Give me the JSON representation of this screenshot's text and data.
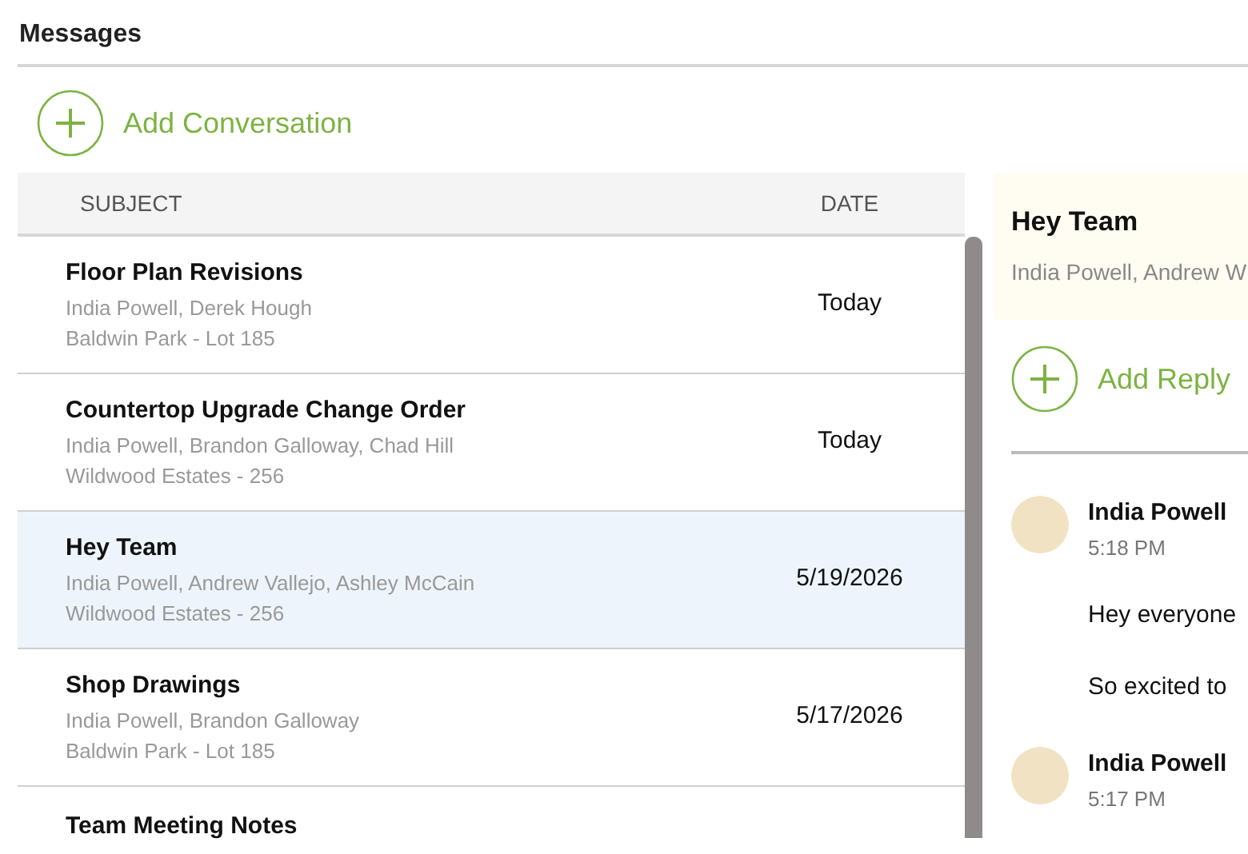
{
  "header": {
    "title": "Messages"
  },
  "add_conversation": {
    "label": "Add Conversation"
  },
  "table": {
    "columns": [
      "SUBJECT",
      "DATE"
    ],
    "rows": [
      {
        "subject": "Floor Plan Revisions",
        "participants": "India Powell, Derek Hough",
        "project": "Baldwin Park - Lot 185",
        "date": "Today",
        "selected": false
      },
      {
        "subject": "Countertop Upgrade Change Order",
        "participants": "India Powell, Brandon Galloway, Chad Hill",
        "project": "Wildwood Estates - 256",
        "date": "Today",
        "selected": false
      },
      {
        "subject": "Hey Team",
        "participants": "India Powell, Andrew Vallejo, Ashley McCain",
        "project": "Wildwood Estates - 256",
        "date": "5/19/2026",
        "selected": true
      },
      {
        "subject": "Shop Drawings",
        "participants": "India Powell, Brandon Galloway",
        "project": "Baldwin Park - Lot 185",
        "date": "5/17/2026",
        "selected": false
      },
      {
        "subject": "Team Meeting Notes",
        "selected": false
      }
    ]
  },
  "detail": {
    "title": "Hey Team",
    "participants": "India Powell, Andrew W",
    "add_reply": {
      "label": "Add Reply"
    },
    "messages": [
      {
        "author": "India Powell",
        "time": "5:18 PM",
        "paragraphs": [
          "Hey everyone",
          "So excited to"
        ]
      },
      {
        "author": "India Powell",
        "time": "5:17 PM"
      }
    ]
  }
}
